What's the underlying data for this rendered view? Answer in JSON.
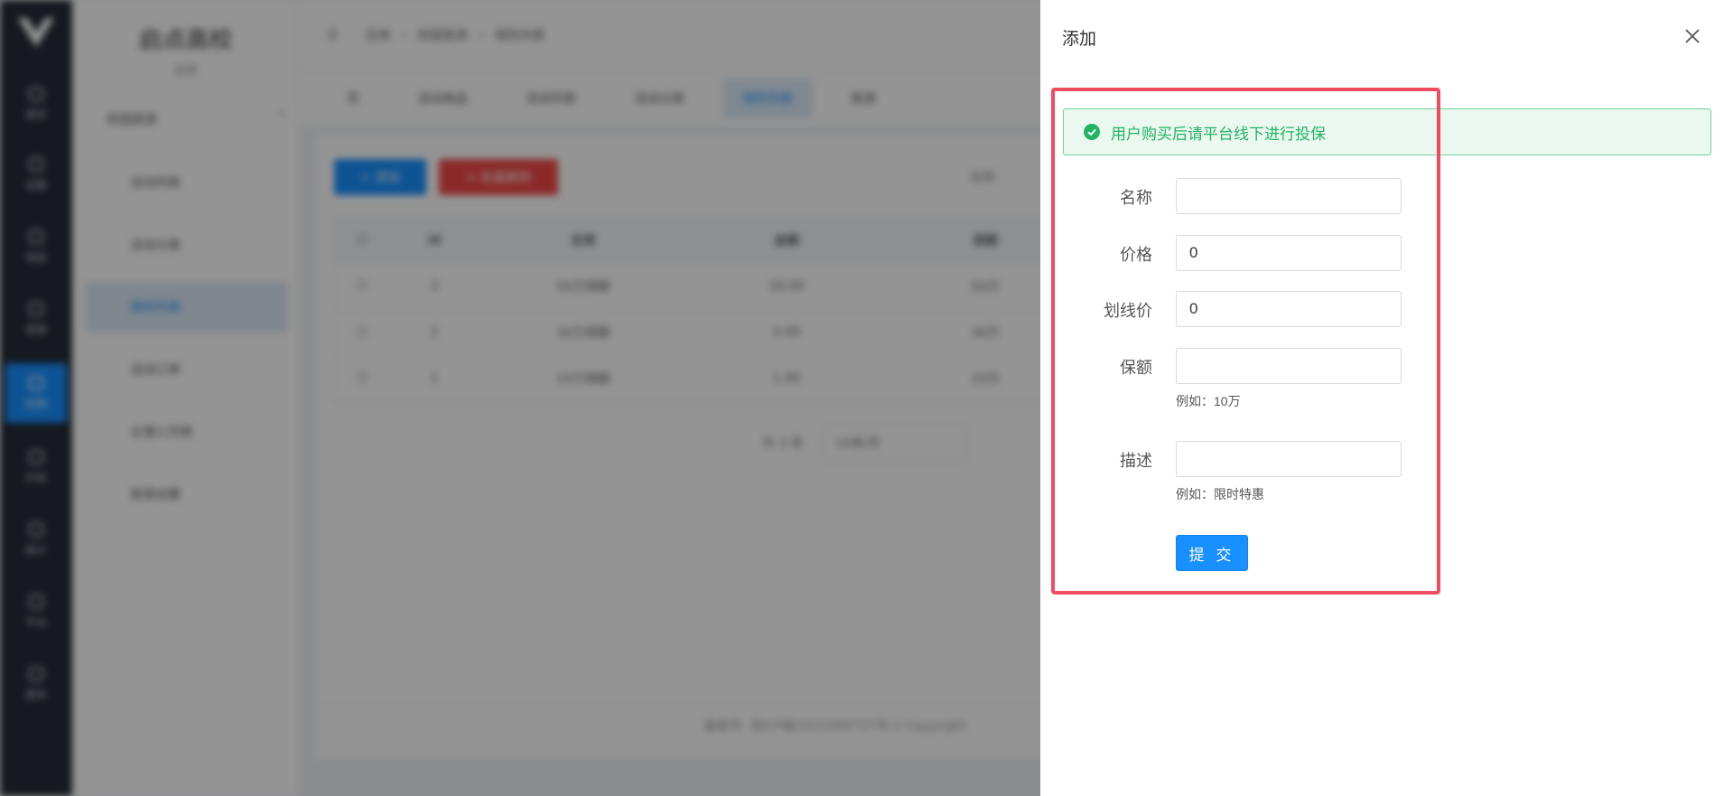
{
  "app": {
    "logo": "V",
    "rail": [
      {
        "label": "首页"
      },
      {
        "label": "设置"
      },
      {
        "label": "商品"
      },
      {
        "label": "营销"
      },
      {
        "label": "应用"
      },
      {
        "label": "外卖"
      },
      {
        "label": "统计"
      },
      {
        "label": "平台"
      },
      {
        "label": "更多"
      }
    ],
    "subnav": {
      "title": "启点高校",
      "subtitle": "应用",
      "group": "校园旅游",
      "items": [
        {
          "label": "活动列表"
        },
        {
          "label": "活动分类"
        },
        {
          "label": "保险列表"
        },
        {
          "label": "活动订单"
        },
        {
          "label": "主理人列表"
        },
        {
          "label": "旅游设置"
        }
      ]
    },
    "breadcrumb": [
      "应用",
      "校园旅游",
      "保险列表"
    ],
    "tabs": [
      "页",
      "活动商品",
      "活动列表",
      "活动分类",
      "保险列表",
      "旅游"
    ],
    "toolbar": {
      "add": "+ 添加",
      "batch_delete": "× 批量删除",
      "search_label": "名称"
    },
    "table": {
      "headers": [
        "",
        "id",
        "名称",
        "金额",
        "保额"
      ],
      "rows": [
        [
          "",
          "3",
          "50万保额",
          "18.00",
          "50万"
        ],
        [
          "",
          "2",
          "30万保额",
          "3.00",
          "30万"
        ],
        [
          "",
          "1",
          "10万保额",
          "1.00",
          "10万"
        ]
      ]
    },
    "pager": {
      "total": "共 3 条",
      "page_size": "10条/页"
    },
    "footer": "备案号: 浙ICP备2021000707号-2 Copyright"
  },
  "drawer": {
    "title": "添加",
    "alert": "用户购买后请平台线下进行投保",
    "fields": {
      "name": {
        "label": "名称",
        "value": ""
      },
      "price": {
        "label": "价格",
        "value": "0"
      },
      "strike_price": {
        "label": "划线价",
        "value": "0"
      },
      "coverage": {
        "label": "保额",
        "value": "",
        "hint": "例如：10万"
      },
      "description": {
        "label": "描述",
        "value": "",
        "hint": "例如：限时特惠"
      }
    },
    "submit": "提 交"
  },
  "colors": {
    "accent": "#1890ff",
    "highlight": "#f04b5f",
    "success": "#23b364"
  }
}
